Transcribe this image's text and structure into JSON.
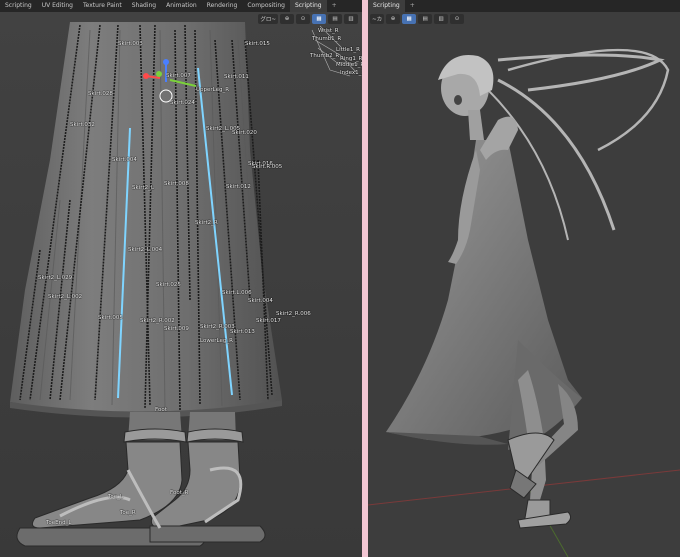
{
  "left_tabs": [
    "Scripting",
    "UV Editing",
    "Texture Paint",
    "Shading",
    "Animation",
    "Rendering",
    "Compositing",
    "Scripting",
    "+"
  ],
  "left_toolbar": [
    "グロ~",
    "⊕",
    "⊙",
    "▦",
    "▤",
    "▥"
  ],
  "right_tabs": [
    "Scripting",
    "+"
  ],
  "right_toolbar": [
    "~カ",
    "⊕",
    "▦",
    "▤",
    "▥",
    "⊙"
  ],
  "bone_labels": [
    "Skirt.003",
    "Skirt.015",
    "Skirt.007",
    "Skirt.011",
    "UpperLeg_R",
    "Skirt.028",
    "Skirt.024",
    "Skirt2_L.005",
    "Skirt.020",
    "Skirt.032",
    "Skirt.004",
    "Skirt.016",
    "Skirt.R.005",
    "Skirt.008",
    "Skirt2_L",
    "Skirt.012",
    "Skirt2_R",
    "Skirt2_L.004",
    "Skirt2_L.029",
    "Skirt.025",
    "Skirt2_L.002",
    "Skirt.L.006",
    "Skirt.004",
    "Skirt2_R.006",
    "Skirt.005",
    "Skirt2_R.002",
    "Skirt.017",
    "Skirt.009",
    "Skirt2_R.003",
    "Skirt.013",
    "LowerLeg_R",
    "Foot",
    "Toe_L",
    "Foot_R",
    "Toe_R",
    "ToeEnd_L"
  ],
  "hand_labels": [
    "Wrist_R",
    "Thumb1_R",
    "Little1_R",
    "Thumb2_R",
    "Ring1_R",
    "Middle1_R",
    "Index1_R"
  ]
}
